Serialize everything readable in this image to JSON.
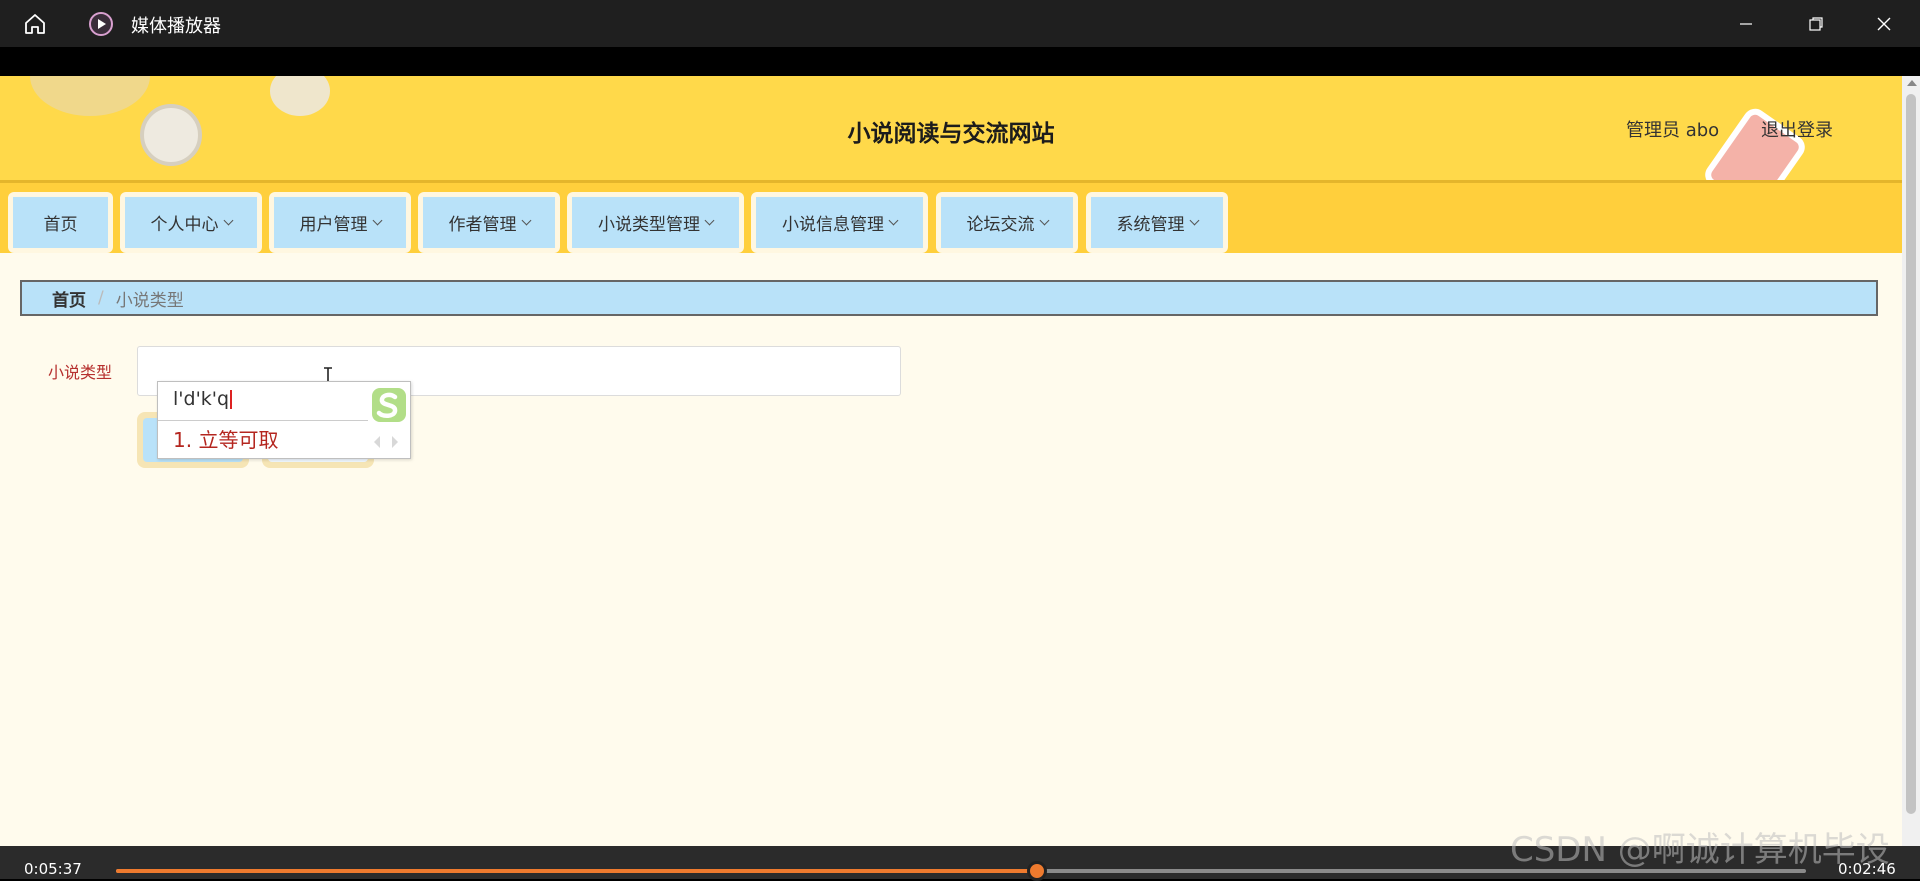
{
  "window": {
    "title": "媒体播放器",
    "icons": {
      "home": "home-icon",
      "app": "media-player-icon",
      "minimize": "minimize-icon",
      "restore": "restore-icon",
      "close": "close-icon"
    }
  },
  "site": {
    "title": "小说阅读与交流网站",
    "user_label": "管理员 abo",
    "logout_label": "退出登录"
  },
  "nav": {
    "items": [
      {
        "label": "首页",
        "has_dropdown": false
      },
      {
        "label": "个人中心",
        "has_dropdown": true
      },
      {
        "label": "用户管理",
        "has_dropdown": true
      },
      {
        "label": "作者管理",
        "has_dropdown": true
      },
      {
        "label": "小说类型管理",
        "has_dropdown": true
      },
      {
        "label": "小说信息管理",
        "has_dropdown": true
      },
      {
        "label": "论坛交流",
        "has_dropdown": true
      },
      {
        "label": "系统管理",
        "has_dropdown": true
      }
    ]
  },
  "breadcrumb": {
    "home": "首页",
    "separator": "/",
    "current": "小说类型"
  },
  "form": {
    "label": "小说类型",
    "value": ""
  },
  "ime": {
    "composition": "l'd'k'q",
    "candidate": "1. 立等可取",
    "logo_icon": "sogou-icon"
  },
  "player": {
    "current_time": "0:05:37",
    "remaining_time": "0:02:46",
    "progress": 0.545
  },
  "watermark": "CSDN @啊诚计算机毕设",
  "colors": {
    "accent_yellow": "#ffd94a",
    "nav_button": "#b9e2f9",
    "label_red": "#b6302e",
    "page_bg": "#fffbed",
    "progress": "#ee7a2e"
  }
}
